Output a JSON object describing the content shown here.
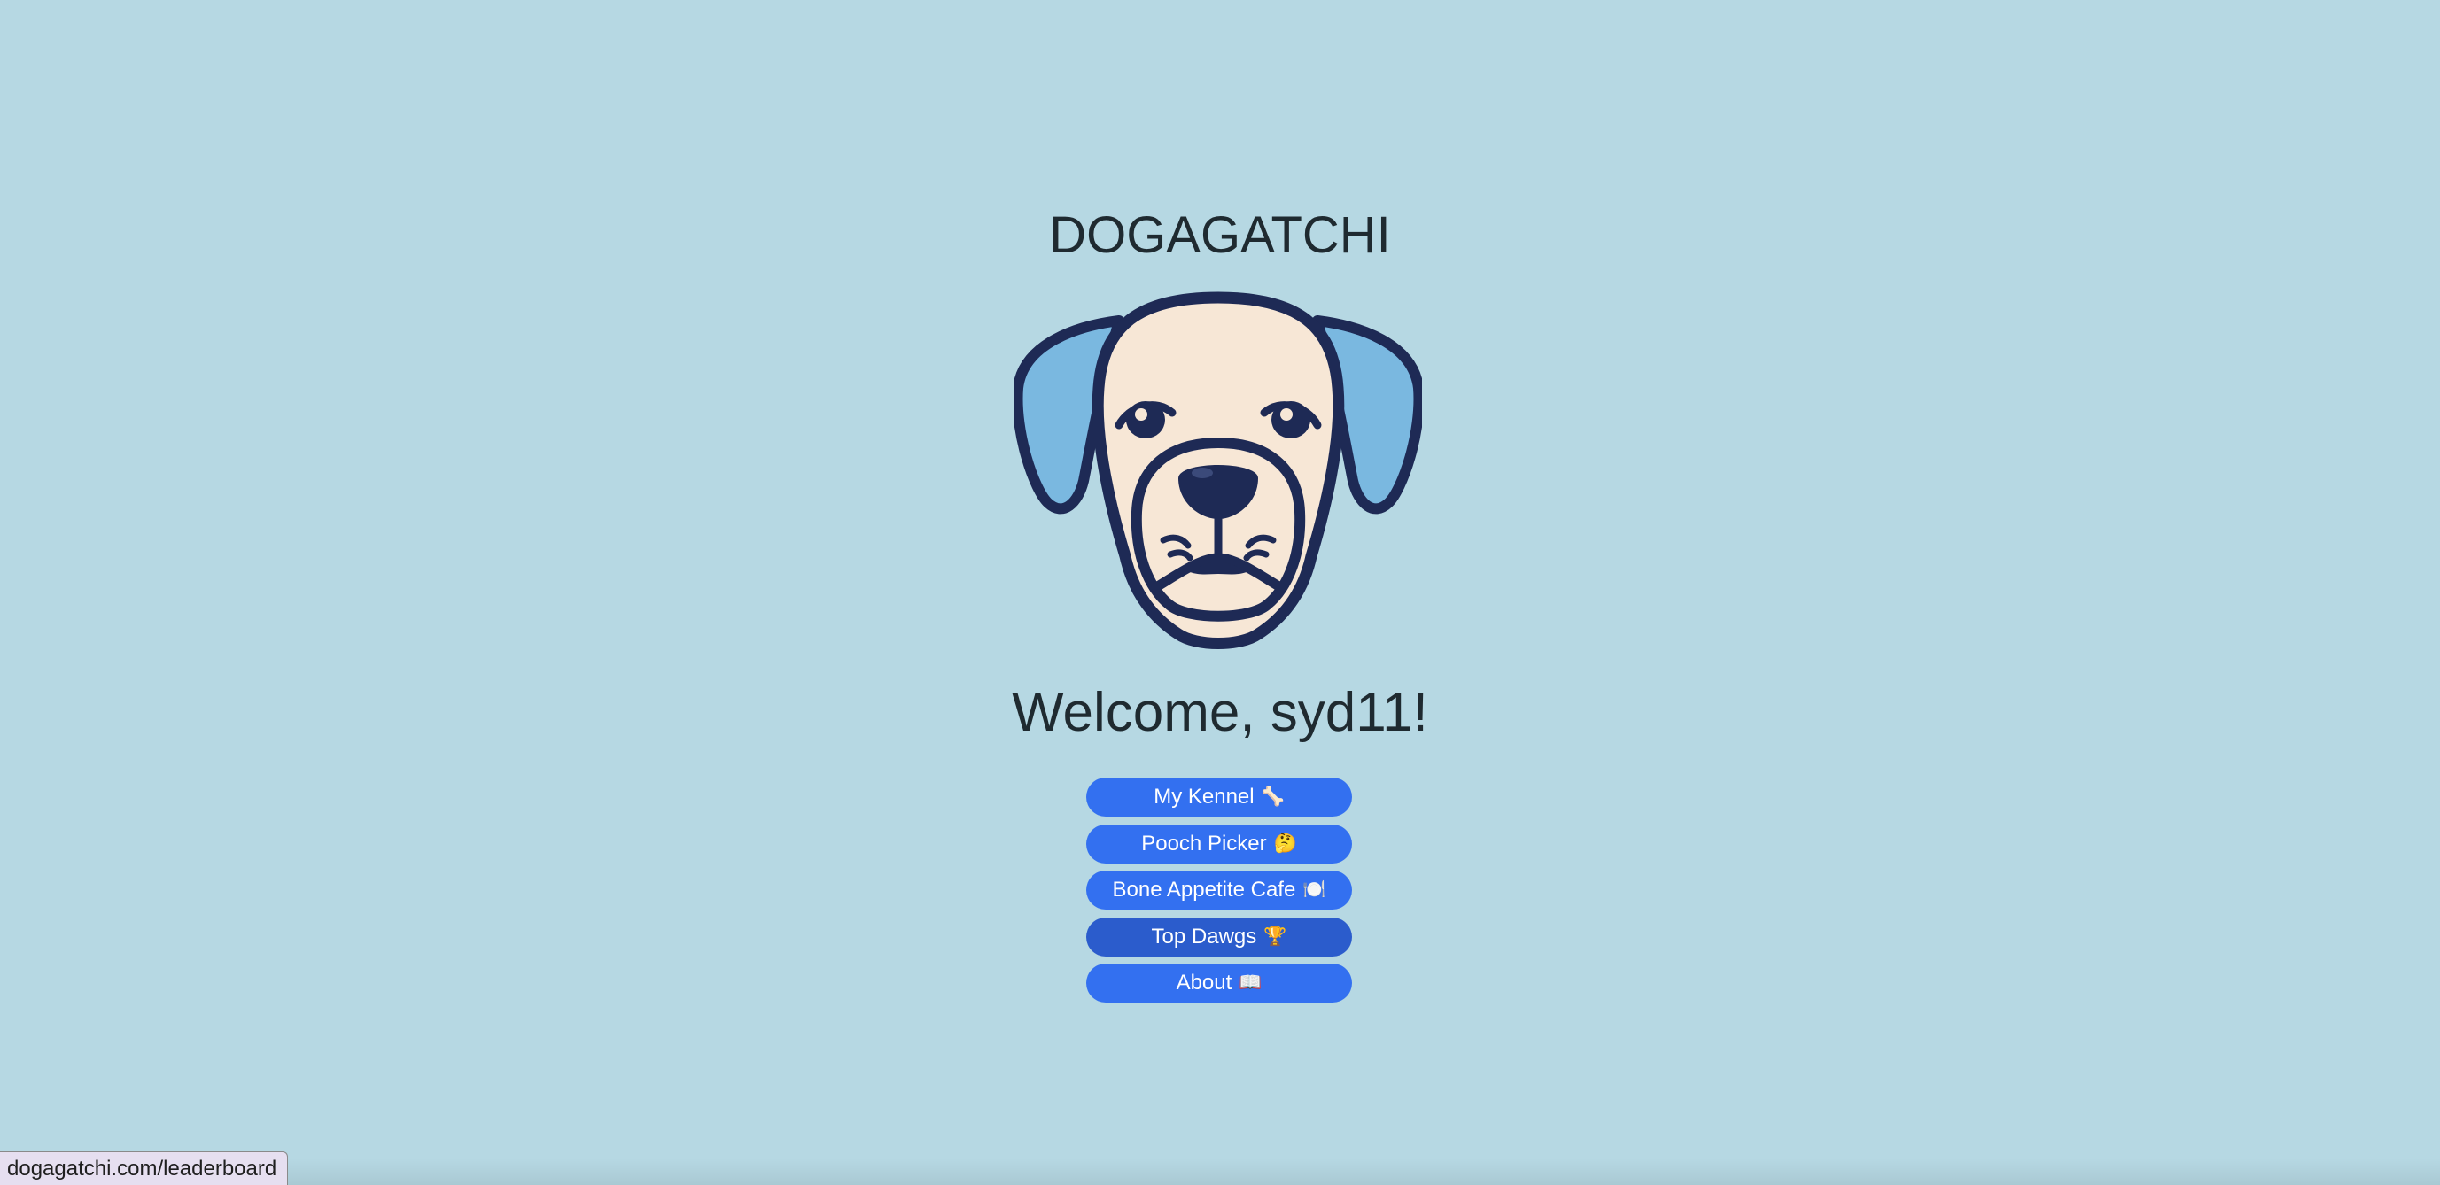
{
  "app": {
    "title": "DOGAGATCHI",
    "logo_icon": "dog-face-icon"
  },
  "welcome": {
    "text": "Welcome, syd11!"
  },
  "nav": {
    "items": [
      {
        "label": "My Kennel",
        "emoji": "🦴",
        "icon": "bone-icon",
        "state": "default"
      },
      {
        "label": "Pooch Picker",
        "emoji": "🤔",
        "icon": "thinking-face-icon",
        "state": "default"
      },
      {
        "label": "Bone Appetite Cafe",
        "emoji": "🍽️",
        "icon": "plate-icon",
        "state": "default"
      },
      {
        "label": "Top Dawgs",
        "emoji": "🏆",
        "icon": "trophy-icon",
        "state": "hover"
      },
      {
        "label": "About",
        "emoji": "📖",
        "icon": "book-icon",
        "state": "default"
      }
    ]
  },
  "status_bar": {
    "url": "dogagatchi.com/leaderboard"
  },
  "colors": {
    "background": "#b6d8e3",
    "button": "#3370f0",
    "button_hover": "#2b5ccc",
    "text": "#1f2a30",
    "dog_outline": "#1e2a55",
    "dog_face": "#f7e7d6",
    "dog_ears": "#7ab8e0"
  }
}
